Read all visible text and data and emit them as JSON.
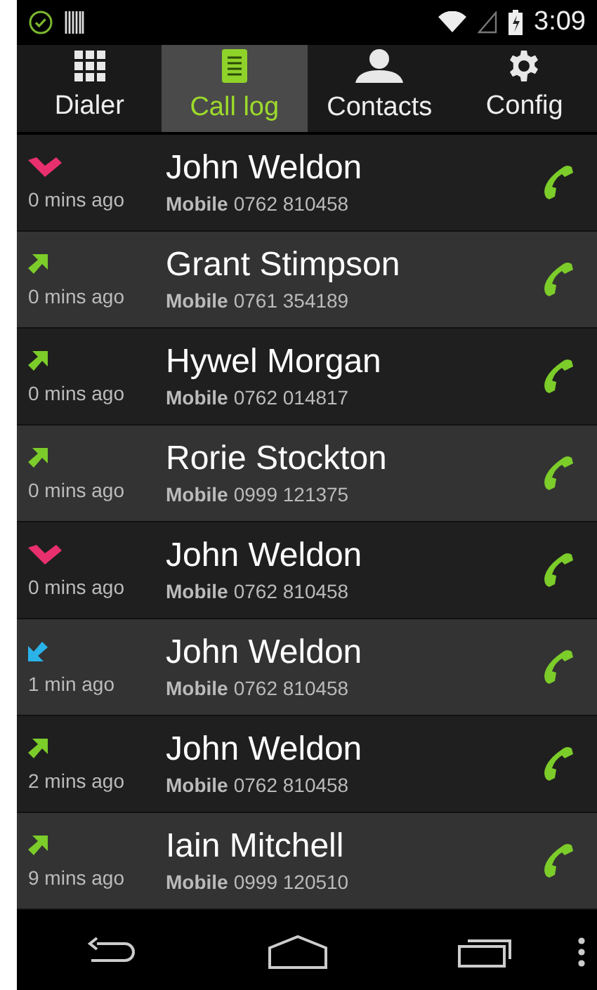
{
  "status_bar": {
    "time": "3:09"
  },
  "tabs": [
    {
      "label": "Dialer",
      "kind": "grid",
      "selected": false
    },
    {
      "label": "Call log",
      "kind": "log",
      "selected": true
    },
    {
      "label": "Contacts",
      "kind": "person",
      "selected": false
    },
    {
      "label": "Config",
      "kind": "gear",
      "selected": false
    }
  ],
  "calls": [
    {
      "kind": "missed",
      "time": "0 mins ago",
      "name": "John Weldon",
      "type": "Mobile",
      "number": "0762 810458"
    },
    {
      "kind": "outgoing",
      "time": "0 mins ago",
      "name": "Grant Stimpson",
      "type": "Mobile",
      "number": "0761 354189"
    },
    {
      "kind": "outgoing",
      "time": "0 mins ago",
      "name": "Hywel Morgan",
      "type": "Mobile",
      "number": "0762 014817"
    },
    {
      "kind": "outgoing",
      "time": "0 mins ago",
      "name": "Rorie Stockton",
      "type": "Mobile",
      "number": "0999 121375"
    },
    {
      "kind": "missed",
      "time": "0 mins ago",
      "name": "John Weldon",
      "type": "Mobile",
      "number": "0762 810458"
    },
    {
      "kind": "incoming",
      "time": "1 min ago",
      "name": "John Weldon",
      "type": "Mobile",
      "number": "0762 810458"
    },
    {
      "kind": "outgoing",
      "time": "2 mins ago",
      "name": "John Weldon",
      "type": "Mobile",
      "number": "0762 810458"
    },
    {
      "kind": "outgoing",
      "time": "9 mins ago",
      "name": "Iain Mitchell",
      "type": "Mobile",
      "number": "0999 120510"
    }
  ]
}
